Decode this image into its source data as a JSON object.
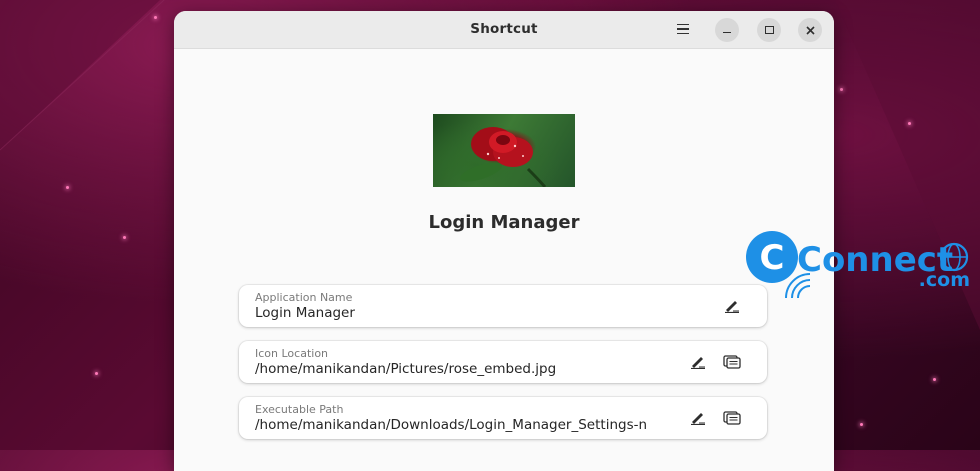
{
  "window": {
    "title": "Shortcut"
  },
  "main": {
    "app_name": "Login Manager",
    "fields": [
      {
        "label": "Application Name",
        "value": "Login Manager"
      },
      {
        "label": "Icon Location",
        "value": "/home/manikandan/Pictures/rose_embed.jpg"
      },
      {
        "label": "Executable Path",
        "value": "/home/manikandan/Downloads/Login_Manager_Settings-n"
      }
    ]
  },
  "icons": {
    "menu": "hamburger-menu-icon",
    "minimize": "minimize-icon",
    "maximize": "maximize-icon",
    "close": "close-icon",
    "edit": "edit-pencil-icon",
    "browse": "browse-file-icon"
  },
  "watermark": {
    "text": "Connect",
    "suffix": ".com"
  },
  "colors": {
    "desktop_bg": "#4a0828",
    "window_bg": "#fafafa",
    "titlebar_bg": "#ebebeb",
    "watermark_blue": "#1e90e6"
  }
}
